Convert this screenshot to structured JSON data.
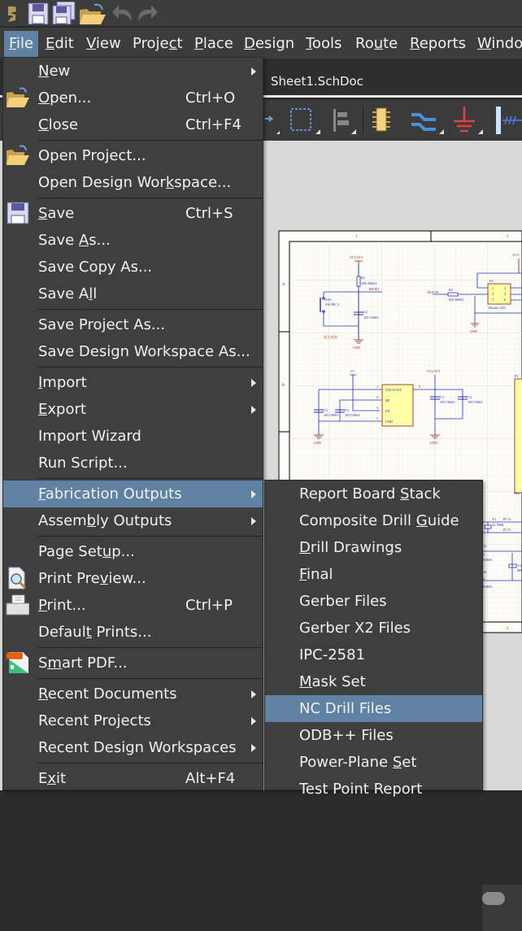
{
  "quick_access": {
    "icons": [
      "altium-logo-icon",
      "save-icon",
      "save-all-icon",
      "open-folder-icon",
      "undo-icon",
      "redo-icon"
    ]
  },
  "menubar": [
    {
      "label": "File",
      "key": "F"
    },
    {
      "label": "Edit",
      "key": "E"
    },
    {
      "label": "View",
      "key": "V"
    },
    {
      "label": "Project",
      "key": "c"
    },
    {
      "label": "Place",
      "key": "P"
    },
    {
      "label": "Design",
      "key": "D"
    },
    {
      "label": "Tools",
      "key": "T"
    },
    {
      "label": "Route",
      "key": "u"
    },
    {
      "label": "Reports",
      "key": "R"
    },
    {
      "label": "Windo",
      "key": "W"
    }
  ],
  "document_tab": "Sheet1.SchDoc",
  "file_menu": [
    {
      "label": "New",
      "key": "N",
      "submenu": true
    },
    {
      "label": "Open...",
      "key": "O",
      "shortcut": "Ctrl+O",
      "icon": "open-folder-icon"
    },
    {
      "label": "Close",
      "key": "C",
      "shortcut": "Ctrl+F4"
    },
    {
      "separator": true
    },
    {
      "label": "Open Project...",
      "key": "",
      "icon": "open-project-icon"
    },
    {
      "label": "Open Design Workspace...",
      "key": "k"
    },
    {
      "separator": true
    },
    {
      "label": "Save",
      "key": "S",
      "shortcut": "Ctrl+S",
      "icon": "save-icon"
    },
    {
      "label": "Save As...",
      "key": "A"
    },
    {
      "label": "Save Copy As...",
      "key": ""
    },
    {
      "label": "Save All",
      "key": "l"
    },
    {
      "separator": true
    },
    {
      "label": "Save Project As...",
      "key": ""
    },
    {
      "label": "Save Design Workspace As...",
      "key": ""
    },
    {
      "separator": true
    },
    {
      "label": "Import",
      "key": "I",
      "submenu": true
    },
    {
      "label": "Export",
      "key": "E",
      "submenu": true
    },
    {
      "label": "Import Wizard",
      "key": ""
    },
    {
      "label": "Run Script...",
      "key": ""
    },
    {
      "separator": true
    },
    {
      "label": "Fabrication Outputs",
      "key": "F",
      "submenu": true,
      "highlighted": true
    },
    {
      "label": "Assembly Outputs",
      "key": "b",
      "submenu": true
    },
    {
      "separator": true
    },
    {
      "label": "Page Setup...",
      "key": "u"
    },
    {
      "label": "Print Preview...",
      "key": "v",
      "icon": "print-preview-icon"
    },
    {
      "label": "Print...",
      "key": "P",
      "shortcut": "Ctrl+P",
      "icon": "printer-icon"
    },
    {
      "label": "Default Prints...",
      "key": "t"
    },
    {
      "separator": true
    },
    {
      "label": "Smart PDF...",
      "key": "m",
      "icon": "smart-pdf-icon"
    },
    {
      "separator": true
    },
    {
      "label": "Recent Documents",
      "key": "R",
      "submenu": true
    },
    {
      "label": "Recent Projects",
      "key": "",
      "submenu": true
    },
    {
      "label": "Recent Design Workspaces",
      "key": "",
      "submenu": true
    },
    {
      "separator": true
    },
    {
      "label": "Exit",
      "key": "x",
      "shortcut": "Alt+F4"
    }
  ],
  "fabrication_menu": [
    {
      "label": "Report Board Stack",
      "key": "S"
    },
    {
      "label": "Composite Drill Guide",
      "key": "G"
    },
    {
      "label": "Drill Drawings",
      "key": "D"
    },
    {
      "label": "Final",
      "key": "F"
    },
    {
      "label": "Gerber Files",
      "key": ""
    },
    {
      "label": "Gerber X2 Files",
      "key": ""
    },
    {
      "label": "IPC-2581",
      "key": ""
    },
    {
      "label": "Mask Set",
      "key": "M"
    },
    {
      "label": "NC Drill Files",
      "key": "",
      "highlighted": true
    },
    {
      "label": "ODB++ Files",
      "key": ""
    },
    {
      "label": "Power-Plane Set",
      "key": "S"
    },
    {
      "label": "Test Point Report",
      "key": ""
    }
  ],
  "schematic": {
    "col_labels": [
      "1",
      "2"
    ],
    "row_labels": [
      "A",
      "B"
    ],
    "vcc1": "VCC3V3",
    "r2": "R2",
    "r2_val": "10K R0603",
    "reset": "RESET",
    "sw1": "SW1",
    "sw1_val": "SW-PB_V",
    "c2": "C2",
    "c2_val": "105 C0603",
    "gnd": "GND",
    "reset_note": "复位电路",
    "boot0": "BOOT0",
    "r3": "R3",
    "r3_val": "10K R0603",
    "p2": "P2",
    "p2_pins": [
      "1",
      "2",
      "3",
      "4",
      "5",
      "6"
    ],
    "p2_val": "Header 3X2",
    "vcc2": "VCC",
    "v5": "5V",
    "vcc3": "VCC3V3",
    "u_pins": [
      "VIN  VOUT",
      "BP",
      "EN",
      "GND"
    ],
    "u_pin_nums": [
      "1",
      "4",
      "3",
      "2",
      "5"
    ],
    "c5": "C5",
    "c5_val": "105 C0603",
    "c6": "C6",
    "c6_val": "105 C0603",
    "c3": "C3",
    "c3_val": "105 C0603",
    "c4": "C4",
    "c4_val": "105 C0603",
    "p3": "P3",
    "pc14": "PC14",
    "pc15": "PC15",
    "y1": "Y1",
    "y1_val": "32.768K",
    "c13": "13",
    "c14": "14",
    "c_val": "P,0603",
    "y2": "Y2",
    "y2_val": "8M",
    "hea": "Hea",
    "sheet_col_bottom": "2"
  },
  "colors": {
    "menu_bg": "#3f3f3f",
    "highlight": "#5f82a3",
    "wire": "#1f2fb0",
    "power": "#8b1a1a",
    "component_fill": "#ffffa8"
  }
}
